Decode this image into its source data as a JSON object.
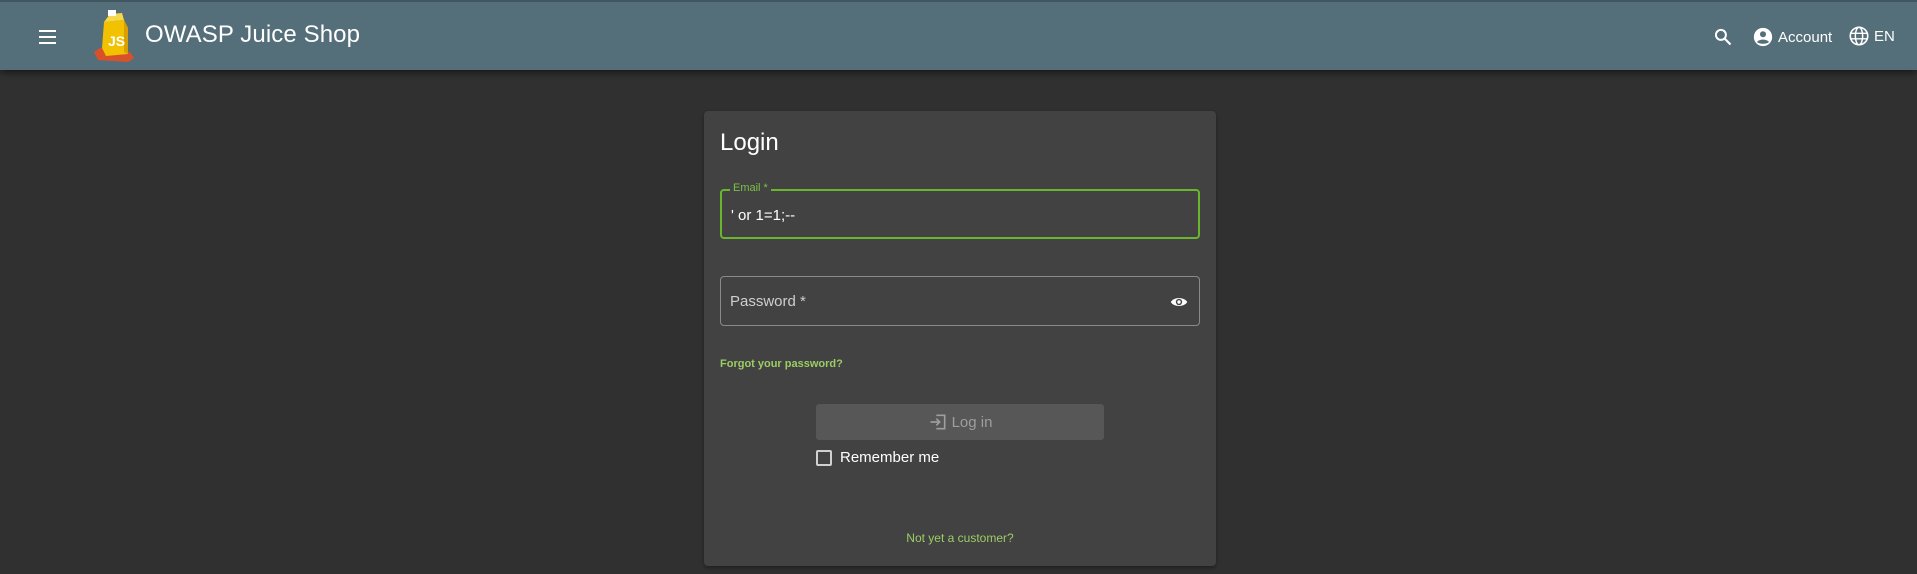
{
  "header": {
    "title": "OWASP Juice Shop",
    "menu_icon": "hamburger-menu-icon",
    "logo": "juice-shop-logo",
    "search_icon": "search-icon",
    "account_label": "Account",
    "account_icon": "account-circle-icon",
    "language_label": "EN",
    "language_icon": "globe-icon",
    "background_color": "#546e7a"
  },
  "login": {
    "title": "Login",
    "email": {
      "label": "Email *",
      "value": "' or 1=1;--"
    },
    "password": {
      "placeholder": "Password *",
      "visibility_icon": "eye-icon"
    },
    "forgot_password": "Forgot your password?",
    "login_button": "Log in",
    "login_icon": "login-arrow-icon",
    "remember_me": "Remember me",
    "register_link": "Not yet a customer?",
    "accent_color": "#69b52b",
    "link_color": "#9ccc65"
  }
}
